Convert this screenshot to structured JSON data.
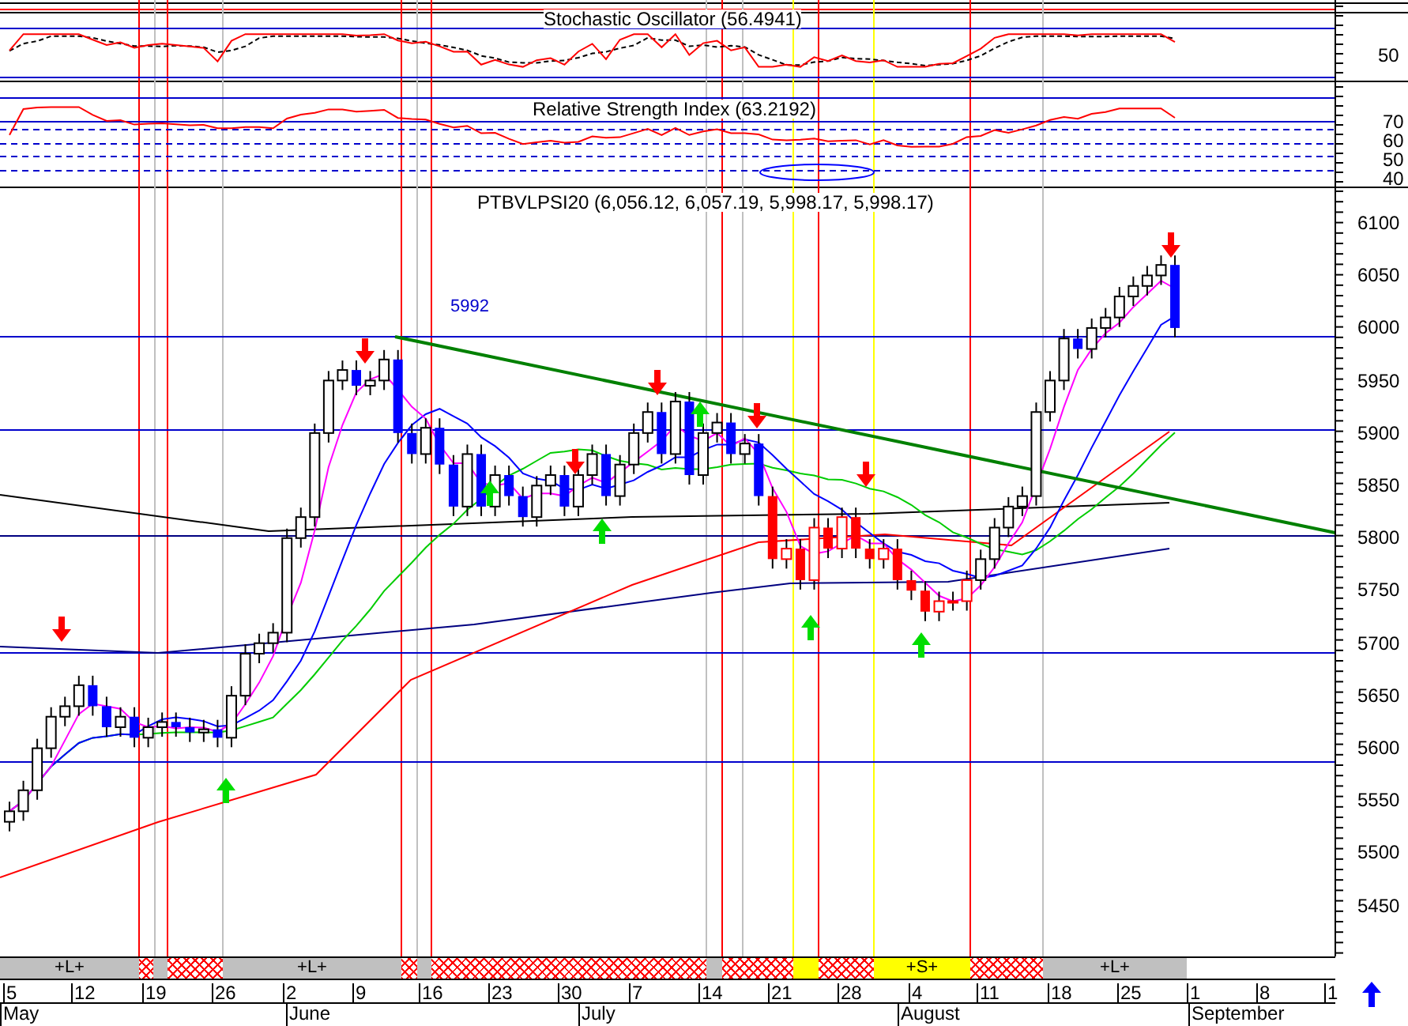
{
  "stochastic": {
    "title": "Stochastic Oscillator (56.4941)",
    "ticks": [
      "50"
    ]
  },
  "rsi": {
    "title": "Relative Strength Index (63.2192)",
    "ticks": [
      "70",
      "60",
      "50",
      "40"
    ]
  },
  "price": {
    "title": "PTBVLPSI20 (6,056.12, 6,057.19, 5,998.17, 5,998.17)",
    "level_label": "5992",
    "ticks": [
      "6100",
      "6050",
      "6000",
      "5950",
      "5900",
      "5850",
      "5800",
      "5750",
      "5700",
      "5650",
      "5600",
      "5550",
      "5500",
      "5450"
    ]
  },
  "signal_bar": [
    {
      "kind": "long",
      "label": "+L+"
    },
    {
      "kind": "neutral"
    },
    {
      "kind": "flat"
    },
    {
      "kind": "neutral"
    },
    {
      "kind": "long",
      "label": "+L+"
    },
    {
      "kind": "neutral"
    },
    {
      "kind": "flat"
    },
    {
      "kind": "neutral"
    },
    {
      "kind": "flat"
    },
    {
      "kind": "neutral"
    },
    {
      "kind": "short"
    },
    {
      "kind": "neutral"
    },
    {
      "kind": "short",
      "label": "+S+"
    },
    {
      "kind": "neutral"
    },
    {
      "kind": "long",
      "label": "+L+"
    }
  ],
  "dates": [
    "5",
    "12",
    "19",
    "26",
    "2",
    "9",
    "16",
    "23",
    "30",
    "7",
    "14",
    "21",
    "28",
    "4",
    "11",
    "18",
    "25",
    "1",
    "8",
    "1"
  ],
  "months": [
    {
      "label": "May"
    },
    {
      "label": "June"
    },
    {
      "label": "July"
    },
    {
      "label": "August"
    },
    {
      "label": "September"
    }
  ]
}
